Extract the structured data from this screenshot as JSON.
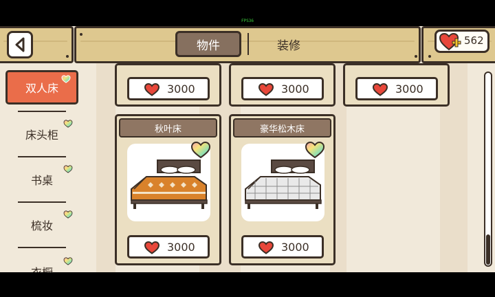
{
  "status": {
    "fps": "FPS36"
  },
  "header": {
    "tabs": [
      {
        "label": "物件",
        "active": true
      },
      {
        "label": "装修",
        "active": false
      }
    ],
    "currency": {
      "value": "562",
      "icon": "heart-plus-icon"
    }
  },
  "sidebar": {
    "categories": [
      {
        "label": "双人床",
        "active": true
      },
      {
        "label": "床头柜",
        "active": false
      },
      {
        "label": "书桌",
        "active": false
      },
      {
        "label": "梳妆",
        "active": false
      },
      {
        "label": "衣橱",
        "active": false
      }
    ]
  },
  "shop": {
    "top_row_prices": [
      "3000",
      "3000",
      "3000"
    ],
    "items": [
      {
        "name": "秋叶床",
        "price": "3000",
        "icon": "autumn-leaf-bed"
      },
      {
        "name": "豪华松木床",
        "price": "3000",
        "icon": "pine-bed"
      }
    ]
  },
  "colors": {
    "accent": "#ea6d4a",
    "tab_active": "#86705f",
    "outline": "#3b2f26",
    "heart": "#e8473a",
    "wood": "#dec88f",
    "card": "#ebdfc2"
  }
}
